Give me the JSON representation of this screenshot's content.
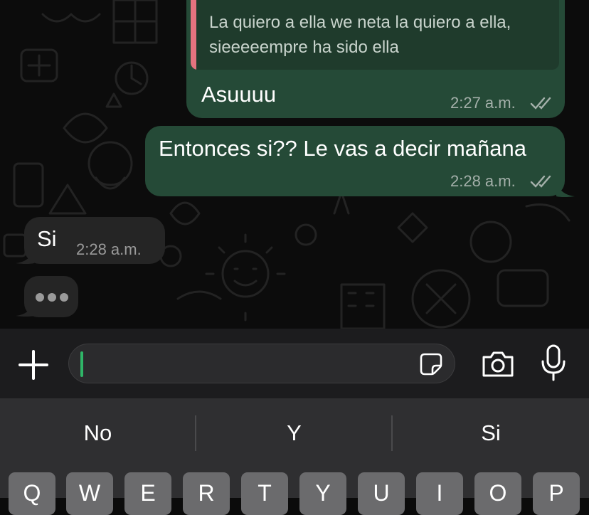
{
  "messages": [
    {
      "direction": "outgoing",
      "quote": "La quiero a ella we neta la quiero a ella, sieeeeempre ha sido ella",
      "text": "Asuuuu",
      "time": "2:27 a.m.",
      "status": "read"
    },
    {
      "direction": "outgoing",
      "text": "Entonces si?? Le vas a decir mañana",
      "time": "2:28 a.m.",
      "status": "read"
    },
    {
      "direction": "incoming",
      "text": "Si",
      "time": "2:28 a.m."
    }
  ],
  "typing_indicator": "typing",
  "composer": {
    "icons": [
      "plus-icon",
      "sticker-icon",
      "camera-icon",
      "microphone-icon"
    ],
    "caret_color": "#2fb567"
  },
  "keyboard": {
    "suggestions": [
      "No",
      "Y",
      "Si"
    ],
    "keys": [
      "Q",
      "W",
      "E",
      "R",
      "T",
      "Y",
      "U",
      "I",
      "O",
      "P"
    ]
  },
  "colors": {
    "outgoing_bubble": "#254a37",
    "incoming_bubble": "#252525",
    "quote_accent": "#e4737f"
  }
}
